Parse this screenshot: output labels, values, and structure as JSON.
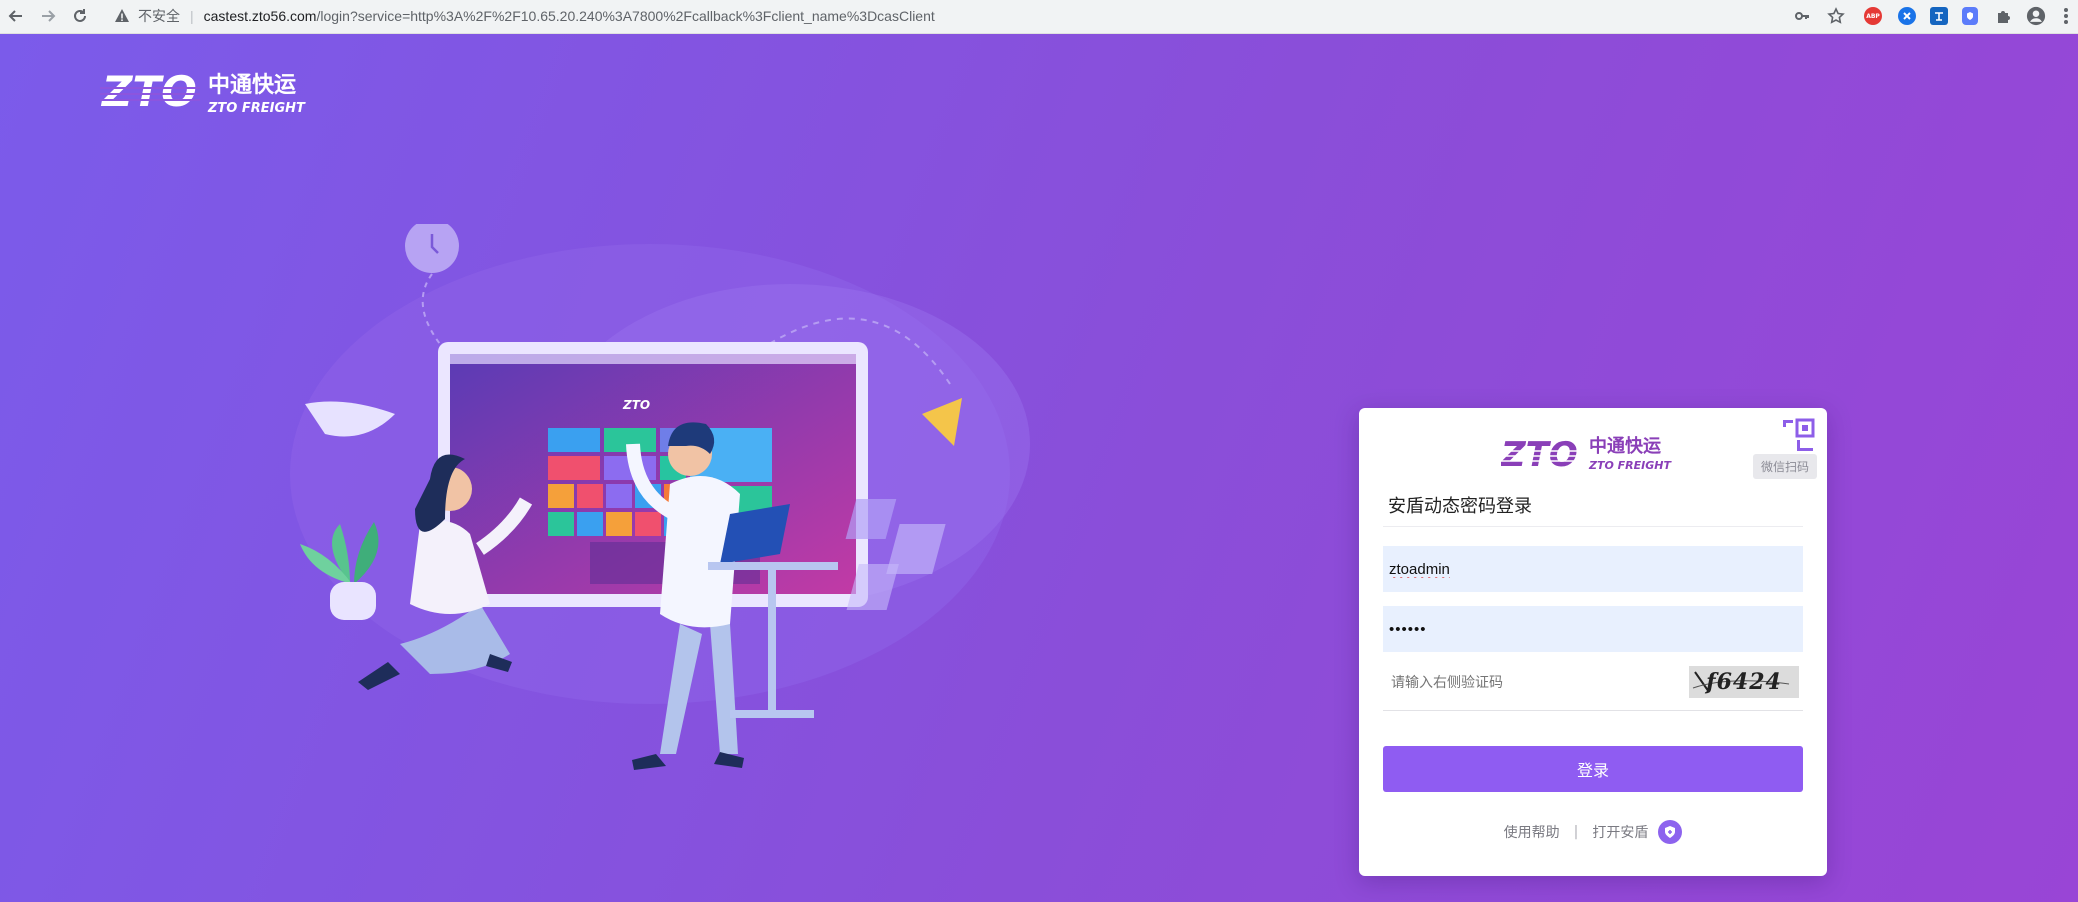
{
  "browser": {
    "security_label": "不安全",
    "url_host": "castest.zto56.com",
    "url_rest": "/login?service=http%3A%2F%2F10.65.20.240%3A7800%2Fcallback%3Fclient_name%3DcasClient",
    "extension_abp_label": "ABP"
  },
  "logo": {
    "mark": "ZTO",
    "cn_name": "中通快运",
    "en_name": "ZTO FREIGHT"
  },
  "login": {
    "qr_label": "微信扫码",
    "title": "安盾动态密码登录",
    "username": "ztoadmin",
    "password_mask": "••••••",
    "captcha_placeholder": "请输入右侧验证码",
    "captcha_text": "f6424",
    "submit_label": "登录",
    "help_label": "使用帮助",
    "separator": "|",
    "open_andun_label": "打开安盾"
  },
  "colors": {
    "bg_start": "#7b5bea",
    "bg_end": "#9945d6",
    "button": "#8f5cf2",
    "logo_purple": "#8a3fb8"
  }
}
